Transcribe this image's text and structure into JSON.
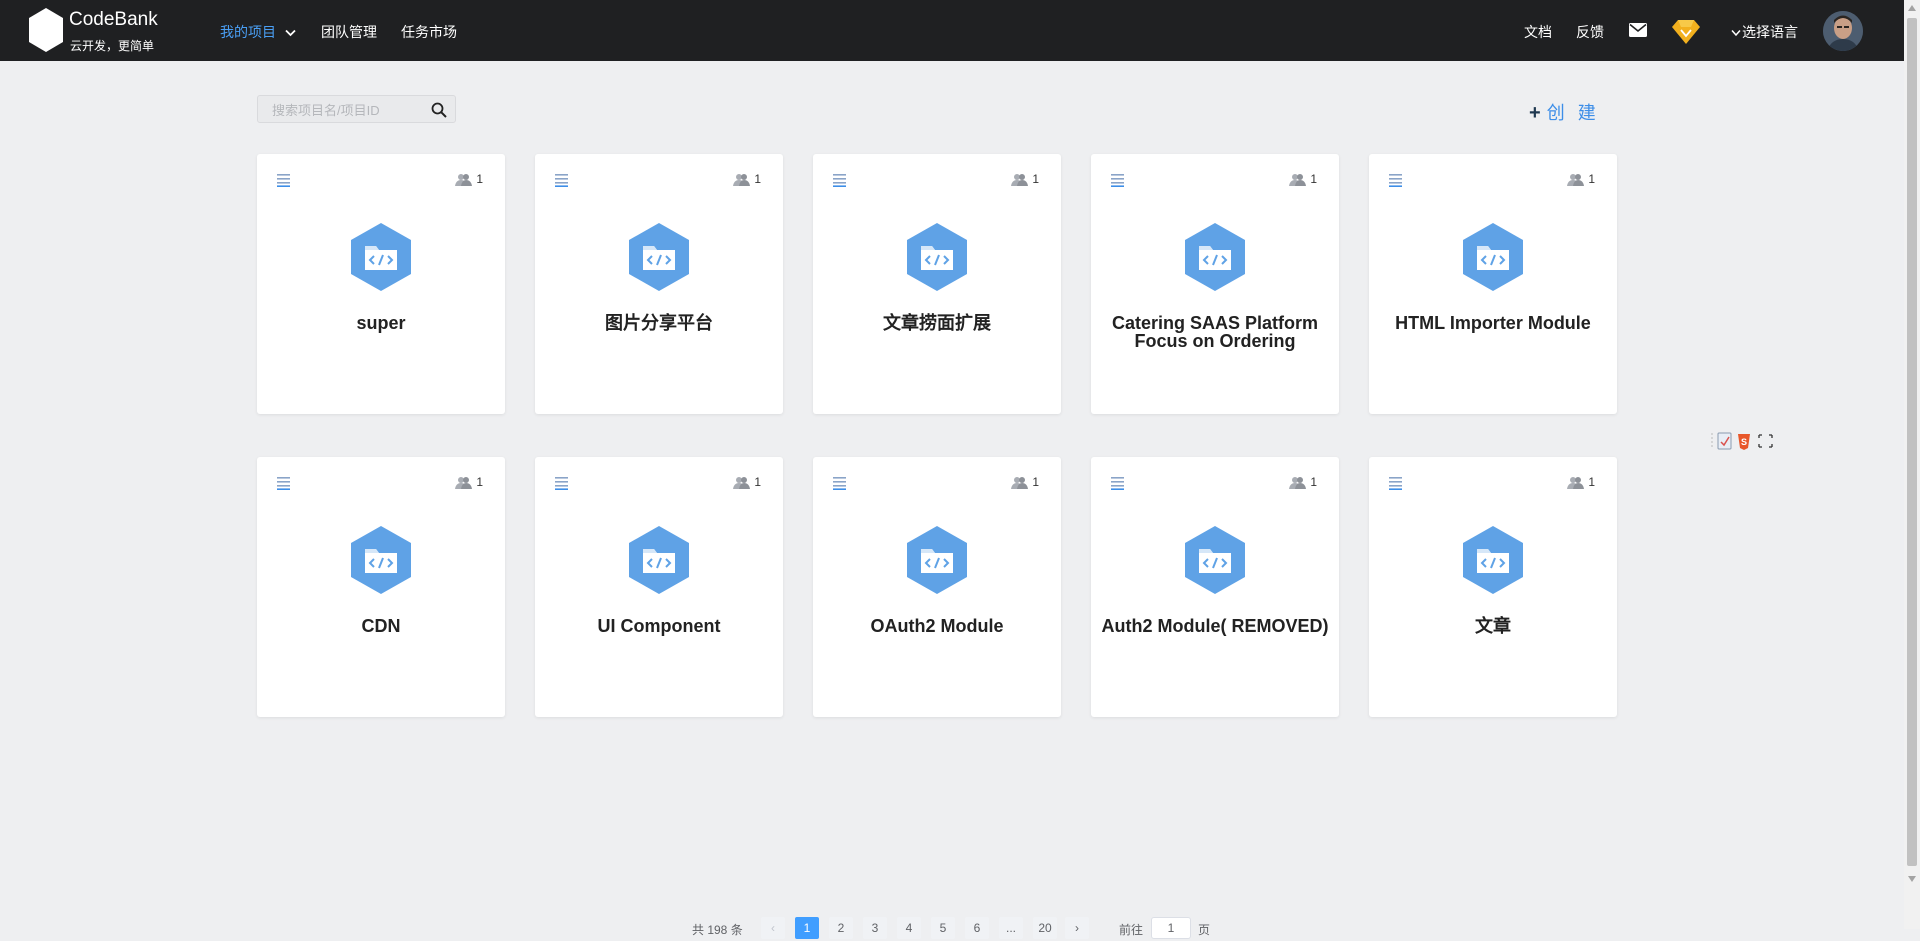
{
  "brand": {
    "name": "CodeBank",
    "slogan": "云开发，更简单"
  },
  "nav": {
    "items": [
      {
        "label": "我的项目",
        "active": true
      },
      {
        "label": "团队管理",
        "active": false
      },
      {
        "label": "任务市场",
        "active": false
      }
    ],
    "right": {
      "docs": "文档",
      "feedback": "反馈",
      "language": "选择语言"
    }
  },
  "search": {
    "placeholder": "搜索项目名/项目ID",
    "value": ""
  },
  "create": {
    "label": "创 建"
  },
  "projects": [
    {
      "title": "super",
      "members": "1"
    },
    {
      "title": "图片分享平台",
      "members": "1"
    },
    {
      "title": "文章捞面扩展",
      "members": "1"
    },
    {
      "title": "Catering SAAS Platform Focus on Ordering",
      "members": "1"
    },
    {
      "title": "HTML Importer Module",
      "members": "1"
    },
    {
      "title": "CDN",
      "members": "1"
    },
    {
      "title": "UI Component",
      "members": "1"
    },
    {
      "title": "OAuth2 Module",
      "members": "1"
    },
    {
      "title": "Auth2 Module( REMOVED)",
      "members": "1"
    },
    {
      "title": "文章",
      "members": "1"
    }
  ],
  "pagination": {
    "total_label": "共 198 条",
    "pages": [
      "1",
      "2",
      "3",
      "4",
      "5",
      "6",
      "...",
      "20"
    ],
    "current": "1",
    "goto_label": "前往",
    "goto_value": "1",
    "page_unit": "页"
  },
  "colors": {
    "topbar": "#1f2022",
    "accent": "#4a9ff5",
    "folder_icon": "#5fa2e6",
    "page_bg": "#eeeff1"
  }
}
